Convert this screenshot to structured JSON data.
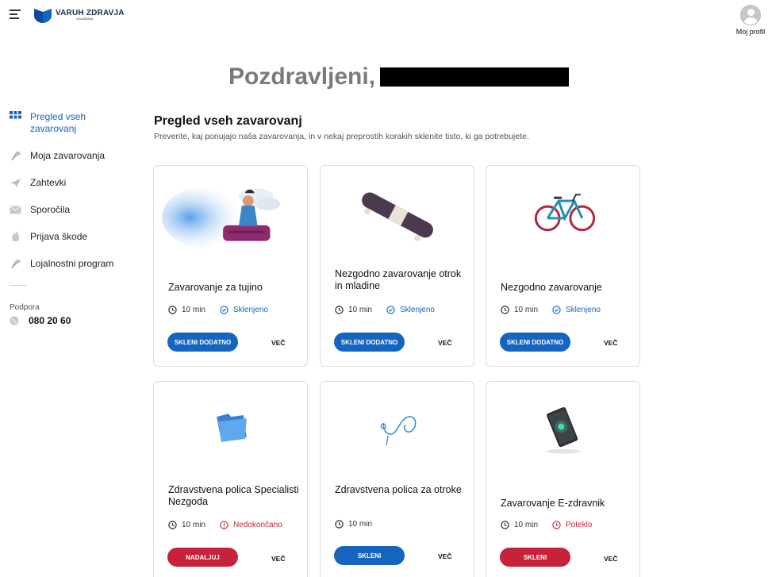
{
  "header": {
    "brand_name": "VARUH ZDRAVJA",
    "brand_sub": "VZAJEMNA",
    "profile_label": "Moj profil"
  },
  "greeting": "Pozdravljeni,",
  "sidebar": {
    "items": [
      {
        "label": "Pregled vseh zavarovanj",
        "icon": "grid-icon",
        "active": true
      },
      {
        "label": "Moja zavarovanja",
        "icon": "umbrella-icon"
      },
      {
        "label": "Zahtevki",
        "icon": "paper-plane-icon"
      },
      {
        "label": "Sporočila",
        "icon": "envelope-icon"
      },
      {
        "label": "Prijava škode",
        "icon": "hand-icon"
      },
      {
        "label": "Lojalnostni program",
        "icon": "umbrella-icon"
      }
    ],
    "support_label": "Podpora",
    "support_phone": "080 20 60"
  },
  "main": {
    "title": "Pregled vseh zavarovanj",
    "subtitle": "Preverite, kaj ponujajo naša zavarovanja, in v nekaj preprostih korakih sklenite tisto, ki ga potrebujete."
  },
  "cards": [
    {
      "title": "Zavarovanje za tujino",
      "duration": "10 min",
      "status": "Sklenjeno",
      "status_type": "done",
      "button": "SKLENI DODATNO",
      "button_color": "#1565c0",
      "more": "VEČ",
      "image": "traveler-on-suitcase"
    },
    {
      "title": "Nezgodno zavarovanje otrok in mladine",
      "duration": "10 min",
      "status": "Sklenjeno",
      "status_type": "done",
      "button": "SKLENI DODATNO",
      "button_color": "#1565c0",
      "more": "VEČ",
      "image": "skateboard"
    },
    {
      "title": "Nezgodno zavarovanje",
      "duration": "10 min",
      "status": "Sklenjeno",
      "status_type": "done",
      "button": "SKLENI DODATNO",
      "button_color": "#1565c0",
      "more": "VEČ",
      "image": "bicycle"
    },
    {
      "title": "Zdravstvena polica Specialisti Nezgoda",
      "duration": "10 min",
      "status": "Nedokončano",
      "status_type": "incomplete",
      "button": "NADALJUJ",
      "button_color": "#c8213b",
      "more": "VEČ",
      "image": "folder"
    },
    {
      "title": "Zdravstvena polica za otroke",
      "duration": "10 min",
      "status": "",
      "status_type": "none",
      "button": "SKLENI",
      "button_color": "#1565c0",
      "more": "VEČ",
      "image": "stethoscope"
    },
    {
      "title": "Zavarovanje E-zdravnik",
      "duration": "10 min",
      "status": "Poteklo",
      "status_type": "expired",
      "button": "SKLENI",
      "button_color": "#c8213b",
      "more": "VEČ",
      "image": "phone"
    }
  ],
  "colors": {
    "blue": "#1565c0",
    "red": "#c8213b",
    "status_done": "#1565c0",
    "status_warn": "#c8213b"
  }
}
